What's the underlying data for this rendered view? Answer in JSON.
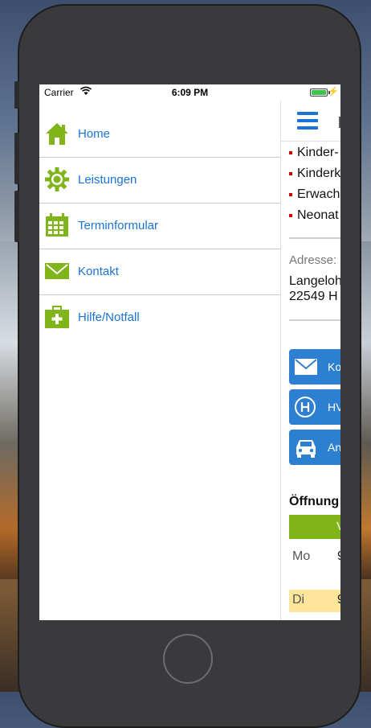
{
  "status_bar": {
    "carrier": "Carrier",
    "time": "6:09 PM",
    "battery_level": 1.0
  },
  "colors": {
    "link_blue": "#1a73d6",
    "icon_green": "#7fb519",
    "button_blue": "#2d7fd1",
    "bullet_red": "#cc0000"
  },
  "menu": {
    "items": [
      {
        "label": "Home",
        "icon": "home-icon"
      },
      {
        "label": "Leistungen",
        "icon": "gear-icon"
      },
      {
        "label": "Terminformular",
        "icon": "calendar-icon"
      },
      {
        "label": "Kontakt",
        "icon": "envelope-icon"
      },
      {
        "label": "Hilfe/Notfall",
        "icon": "first-aid-kit-icon"
      }
    ]
  },
  "content": {
    "menu_icon": "hamburger-icon",
    "bullets": [
      "Kinder-",
      "Kinderk",
      "Erwach",
      "Neonat"
    ],
    "address_label": "Adresse:",
    "address_line1": "Langeloh",
    "address_line2": "22549 H",
    "buttons": [
      {
        "label": "Ko",
        "icon": "envelope-icon"
      },
      {
        "label": "HV",
        "icon": "bus-stop-icon"
      },
      {
        "label": "An",
        "icon": "car-icon"
      }
    ],
    "hours_title": "Öffnung",
    "hours_header": "V",
    "rows": [
      {
        "day": "Mo",
        "value": "9"
      },
      {
        "day": "Di",
        "value": "9"
      }
    ]
  }
}
